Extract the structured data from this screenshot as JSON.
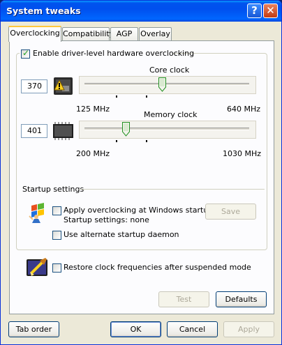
{
  "window": {
    "title": "System tweaks"
  },
  "tabs": [
    {
      "label": "Overclocking"
    },
    {
      "label": "Compatibility"
    },
    {
      "label": "AGP"
    },
    {
      "label": "Overlay"
    }
  ],
  "overclocking": {
    "enable_label": "Enable driver-level hardware overclocking",
    "enable_checked": true,
    "core": {
      "title": "Core clock",
      "value": "370",
      "min_label": "125 MHz",
      "max_label": "640 MHz",
      "slider_fraction": 0.47
    },
    "memory": {
      "title": "Memory clock",
      "value": "401",
      "min_label": "200 MHz",
      "max_label": "1030 MHz",
      "slider_fraction": 0.24
    }
  },
  "startup": {
    "legend": "Startup settings",
    "apply_label": "Apply overclocking at Windows startup",
    "settings_text": "Startup settings: none",
    "daemon_label": "Use alternate startup daemon",
    "save_label": "Save"
  },
  "restore_label": "Restore clock frequencies after suspended mode",
  "buttons": {
    "test": "Test",
    "defaults": "Defaults",
    "tab_order": "Tab order",
    "ok": "OK",
    "cancel": "Cancel",
    "apply": "Apply"
  }
}
